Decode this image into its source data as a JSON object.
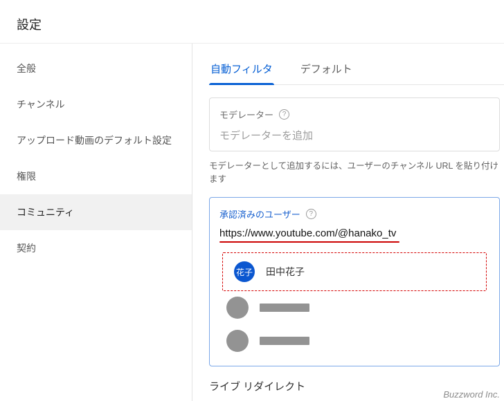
{
  "header": {
    "title": "設定"
  },
  "sidebar": {
    "items": [
      {
        "label": "全般"
      },
      {
        "label": "チャンネル"
      },
      {
        "label": "アップロード動画のデフォルト設定"
      },
      {
        "label": "権限"
      },
      {
        "label": "コミュニティ"
      },
      {
        "label": "契約"
      }
    ],
    "activeIndex": 4
  },
  "tabs": {
    "items": [
      {
        "label": "自動フィルタ"
      },
      {
        "label": "デフォルト"
      }
    ],
    "activeIndex": 0
  },
  "moderatorCard": {
    "label": "モデレーター",
    "placeholder": "モデレーターを追加",
    "hint": "モデレーターとして追加するには、ユーザーのチャンネル URL を貼り付けます"
  },
  "approvedCard": {
    "label": "承認済みのユーザー",
    "inputValue": "https://www.youtube.com/@hanako_tv",
    "results": [
      {
        "avatarText": "花子",
        "name": "田中花子",
        "highlighted": true,
        "kind": "named"
      },
      {
        "kind": "placeholder"
      },
      {
        "kind": "placeholder"
      }
    ]
  },
  "liveRedirectTitle": "ライブ リダイレクト",
  "watermark": "Buzzword Inc."
}
